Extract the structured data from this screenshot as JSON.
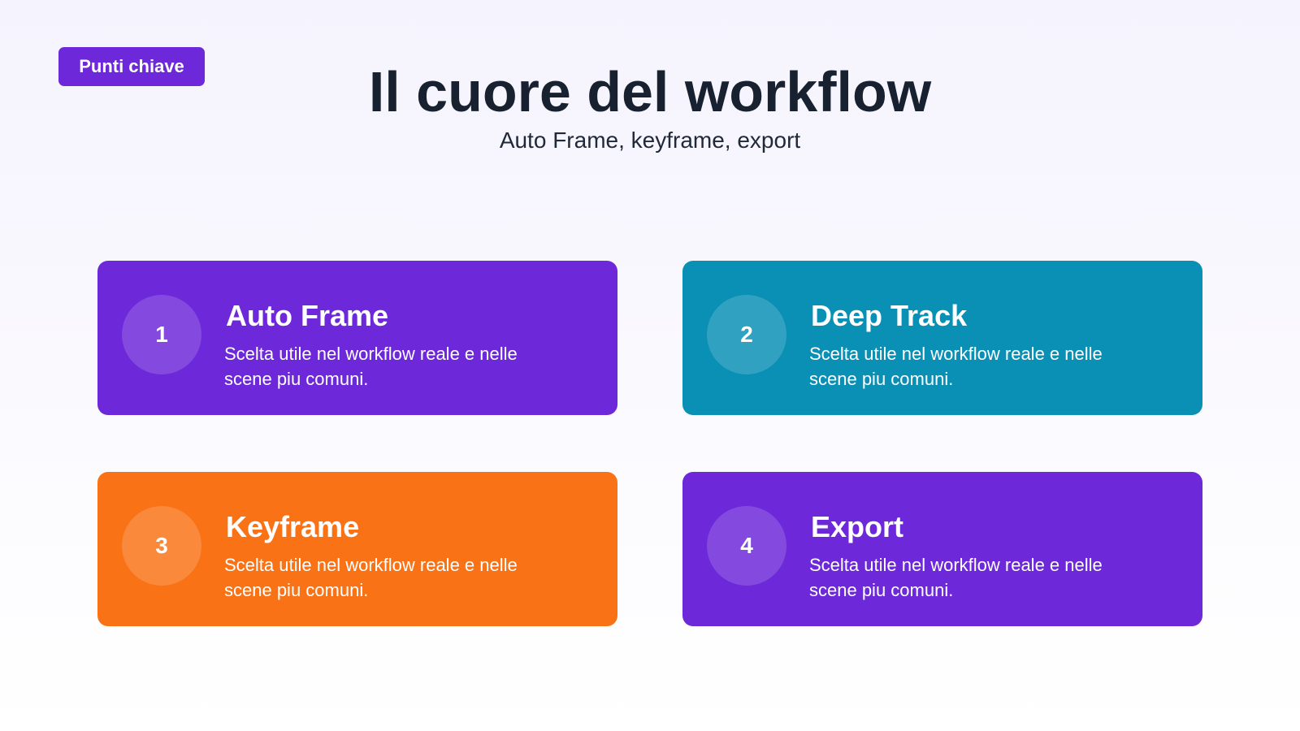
{
  "badge": {
    "label": "Punti chiave",
    "color": "#6d28d9"
  },
  "header": {
    "title": "Il cuore del workflow",
    "subtitle": "Auto Frame, keyframe, export"
  },
  "cards": [
    {
      "number": "1",
      "title": "Auto Frame",
      "description": "Scelta utile nel workflow reale e nelle scene piu comuni.",
      "color": "#6d28d9"
    },
    {
      "number": "2",
      "title": "Deep Track",
      "description": "Scelta utile nel workflow reale e nelle scene piu comuni.",
      "color": "#0a8fb5"
    },
    {
      "number": "3",
      "title": "Keyframe",
      "description": "Scelta utile nel workflow reale e nelle scene piu comuni.",
      "color": "#f97316"
    },
    {
      "number": "4",
      "title": "Export",
      "description": "Scelta utile nel workflow reale e nelle scene piu comuni.",
      "color": "#6d28d9"
    }
  ]
}
